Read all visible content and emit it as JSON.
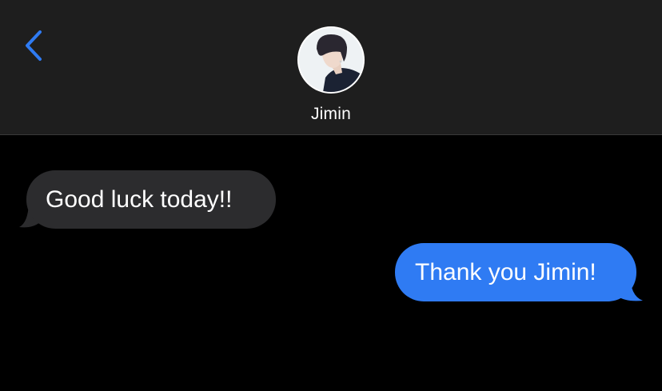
{
  "header": {
    "back_icon": "chevron-left-icon",
    "contact_name": "Jimin",
    "avatar": "contact-photo"
  },
  "messages": [
    {
      "direction": "received",
      "text": "Good luck today!!"
    },
    {
      "direction": "sent",
      "text": "Thank you Jimin!"
    }
  ],
  "colors": {
    "background": "#000000",
    "header_background": "#1e1e1e",
    "accent": "#2f7bf3",
    "received_bubble": "#2c2c2e",
    "sent_bubble": "#2f7bf3",
    "text": "#ffffff"
  }
}
